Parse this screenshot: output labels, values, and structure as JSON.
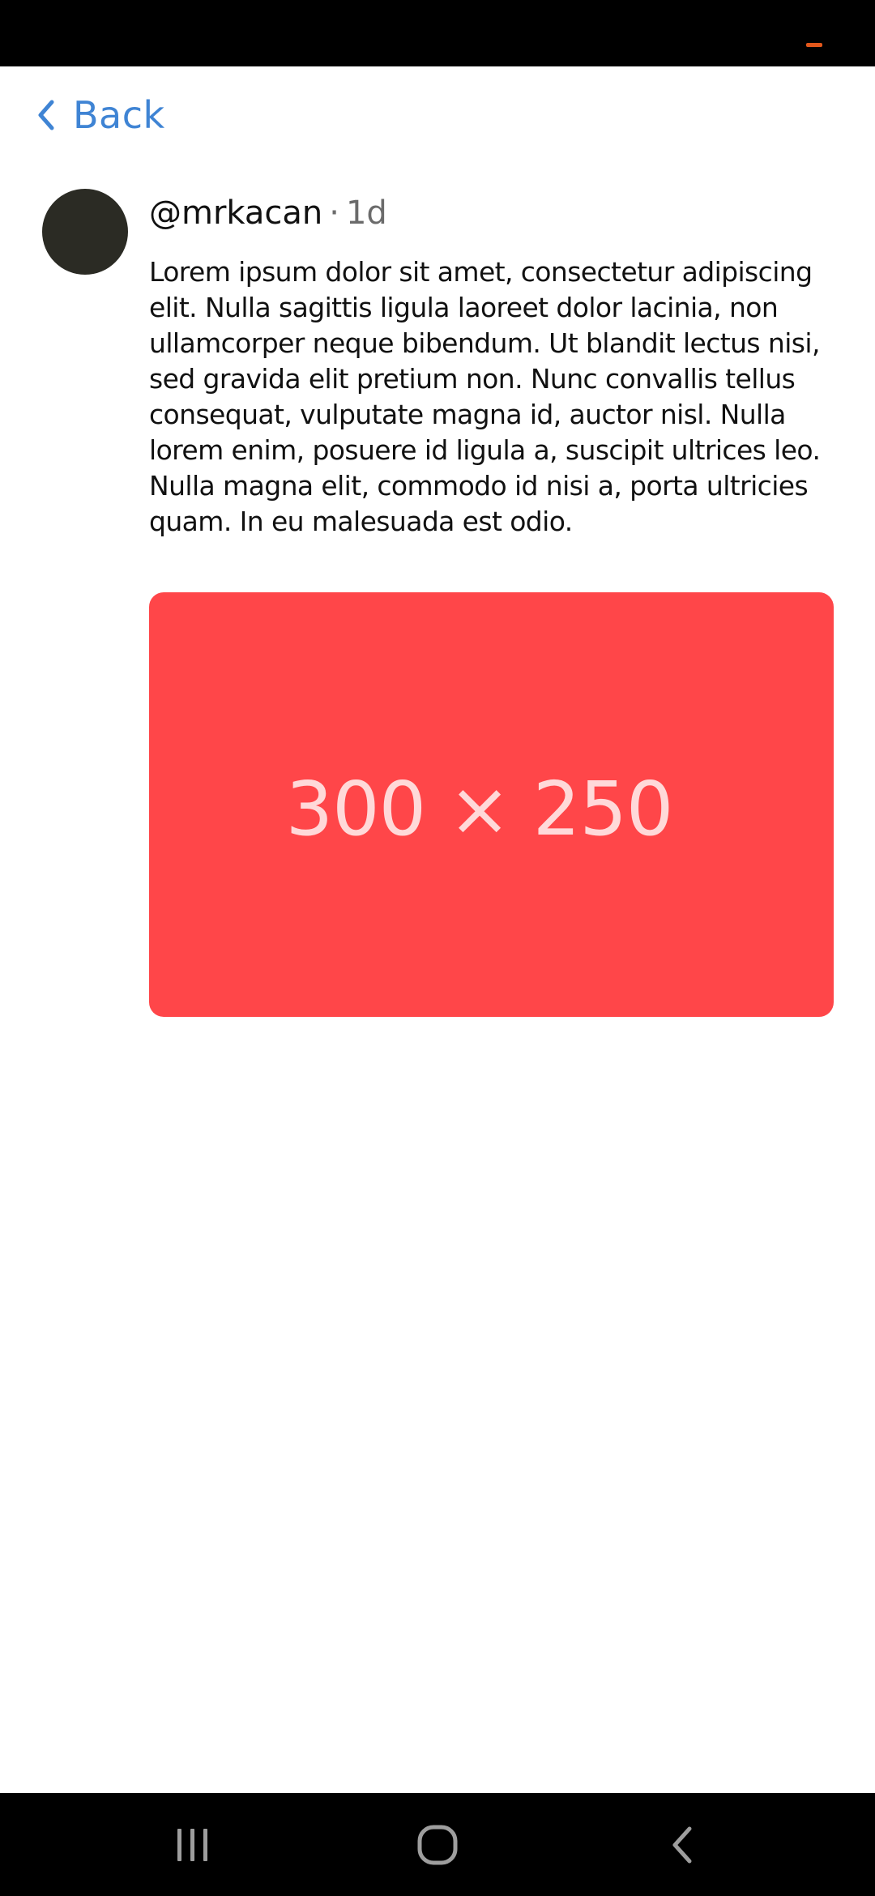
{
  "colors": {
    "accent": "#3f84d4",
    "avatar": "#2b2b24",
    "image_bg": "#ff4649",
    "status_indicator": "#e2571b",
    "nav_icon": "#9e9e9e"
  },
  "status_bar": {
    "indicator_icon": "battery-indicator-icon"
  },
  "header": {
    "back_label": "Back",
    "back_icon": "chevron-left-icon"
  },
  "post": {
    "username": "@mrkacan",
    "separator": "·",
    "timestamp": "1d",
    "body": "Lorem ipsum dolor sit amet, consectetur adipiscing elit. Nulla sagittis ligula laoreet dolor lacinia, non ullamcorper neque bibendum. Ut blandit lectus nisi, sed gravida elit pretium non. Nunc convallis tellus consequat, vulputate magna id, auctor nisl. Nulla lorem enim, posuere id ligula a, suscipit ultrices leo. Nulla magna elit, commodo id nisi a, porta ultricies quam. In eu malesuada est odio.",
    "image_label": "300 × 250"
  },
  "nav_bar": {
    "recents_icon": "recent-apps-icon",
    "home_icon": "home-icon",
    "back_icon": "back-icon"
  }
}
